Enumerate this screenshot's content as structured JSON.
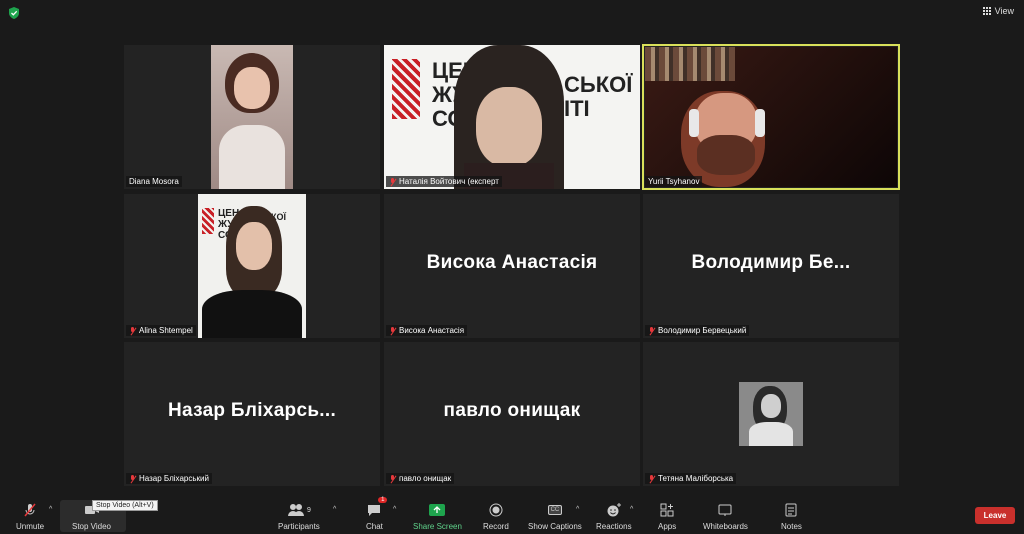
{
  "header": {
    "view_label": "View"
  },
  "tiles": [
    {
      "name": "Diana Mosora",
      "muted": false
    },
    {
      "name": "Наталія Войтович (експерт",
      "muted": true
    },
    {
      "name": "Yurii Tsyhanov",
      "muted": false
    },
    {
      "name": "Alina Shtempel",
      "muted": true
    },
    {
      "name": "Висока Анастасія",
      "big": "Висока Анастасія",
      "muted": true
    },
    {
      "name": "Володимир Бервецький",
      "big": "Володимир  Бе...",
      "muted": true
    },
    {
      "name": "Назар Бліхарський",
      "big": "Назар  Бліхарсь...",
      "muted": true
    },
    {
      "name": "павло онищак",
      "big": "павло онищак",
      "muted": true
    },
    {
      "name": "Тетяна Маліборська",
      "muted": true
    }
  ],
  "toolbar": {
    "unmute": "Unmute",
    "stop_video": "Stop Video",
    "participants": "Participants",
    "participants_count": "9",
    "chat": "Chat",
    "chat_badge": "1",
    "share": "Share Screen",
    "record": "Record",
    "captions": "Show Captions",
    "reactions": "Reactions",
    "apps": "Apps",
    "whiteboards": "Whiteboards",
    "notes": "Notes",
    "leave": "Leave",
    "tooltip": "Stop Video (Alt+V)"
  },
  "colors": {
    "active_border": "#d9e05a",
    "leave": "#c9302c",
    "share": "#1ea44d",
    "mute": "#e5383b"
  }
}
